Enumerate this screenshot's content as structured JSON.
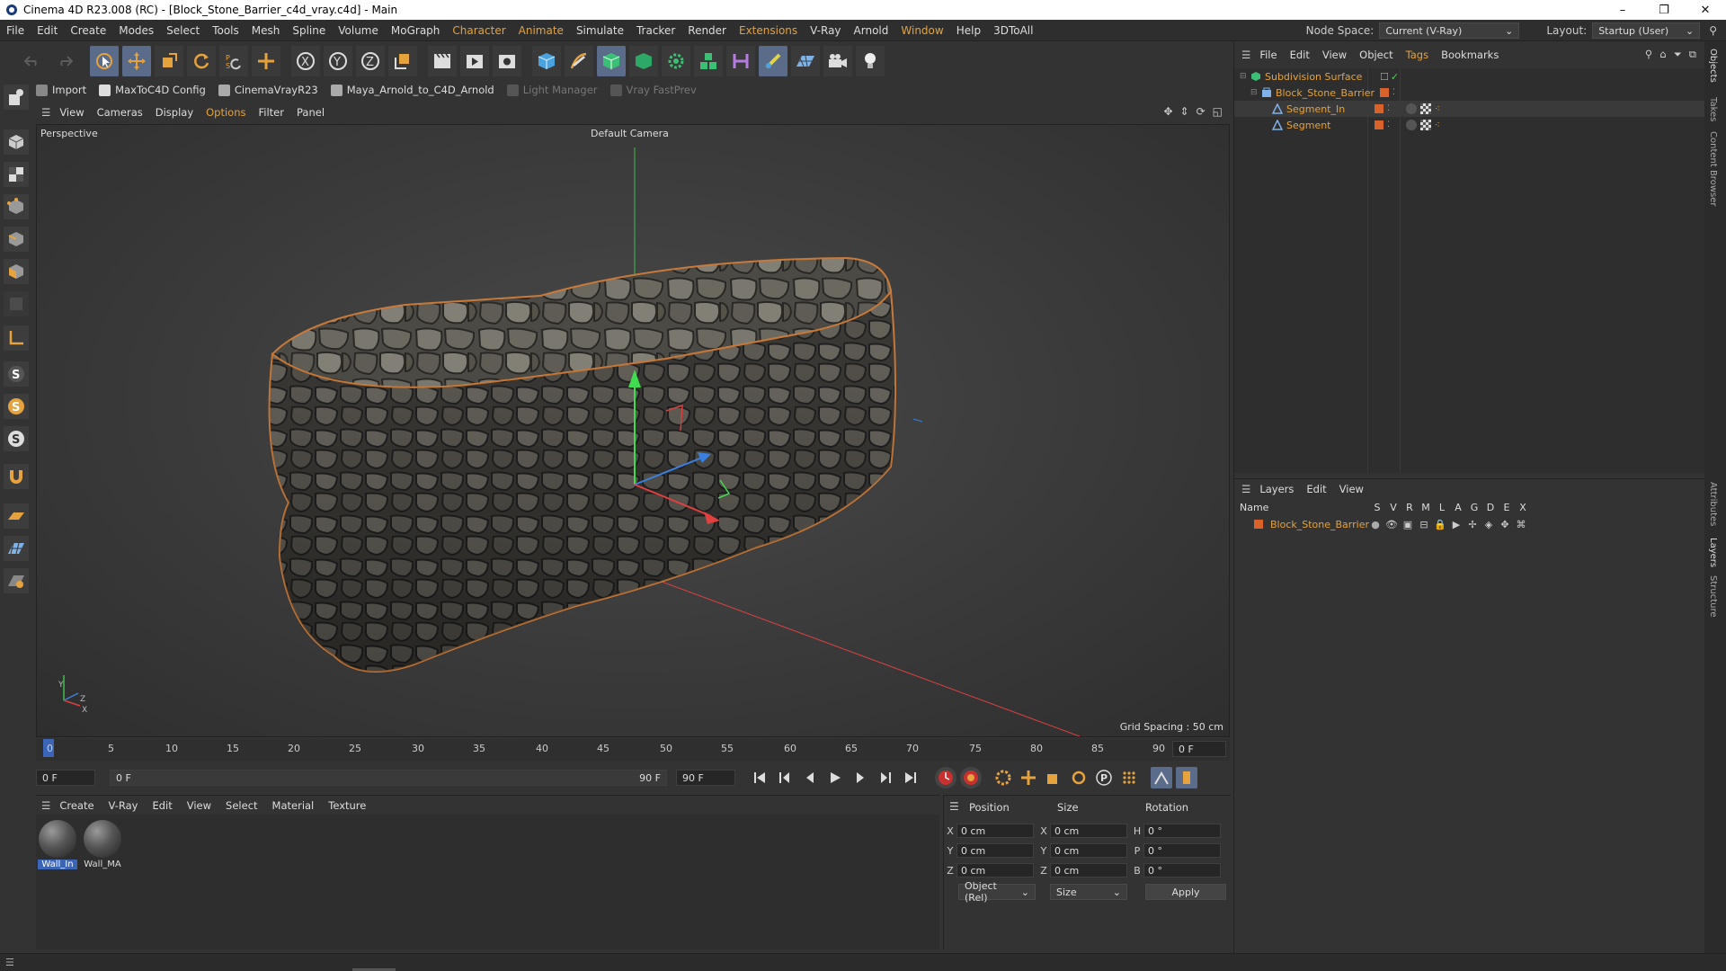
{
  "window": {
    "title": "Cinema 4D R23.008 (RC) - [Block_Stone_Barrier_c4d_vray.c4d] - Main",
    "controls": [
      "–",
      "❐",
      "✕"
    ]
  },
  "menubar": {
    "items": [
      "File",
      "Edit",
      "Create",
      "Modes",
      "Select",
      "Tools",
      "Mesh",
      "Spline",
      "Volume",
      "MoGraph",
      "Character",
      "Animate",
      "Simulate",
      "Tracker",
      "Render",
      "Extensions",
      "V-Ray",
      "Arnold",
      "Window",
      "Help",
      "3DToAll"
    ],
    "highlighted": [
      "Character",
      "Animate",
      "Extensions",
      "Window"
    ],
    "node_space_label": "Node Space:",
    "node_space_value": "Current (V-Ray)",
    "layout_label": "Layout:",
    "layout_value": "Startup (User)"
  },
  "plugins": {
    "items": [
      {
        "label": "Import",
        "enabled": true
      },
      {
        "label": "MaxToC4D Config",
        "enabled": true
      },
      {
        "label": "CinemaVrayR23",
        "enabled": true
      },
      {
        "label": "Maya_Arnold_to_C4D_Arnold",
        "enabled": true
      },
      {
        "label": "Light Manager",
        "enabled": false
      },
      {
        "label": "Vray FastPrev",
        "enabled": false
      }
    ]
  },
  "viewport": {
    "menu": [
      "View",
      "Cameras",
      "Display",
      "Options",
      "Filter",
      "Panel"
    ],
    "menu_highlight": "Options",
    "view_name": "Perspective",
    "camera": "Default Camera",
    "grid_spacing": "Grid Spacing : 50 cm",
    "axis_labels": {
      "y": "Y",
      "z": "Z",
      "x": "X"
    }
  },
  "timeline": {
    "ticks": [
      "0",
      "5",
      "10",
      "15",
      "20",
      "25",
      "30",
      "35",
      "40",
      "45",
      "50",
      "55",
      "60",
      "65",
      "70",
      "75",
      "80",
      "85",
      "90"
    ],
    "current_frame": "0 F",
    "start_field": "0 F",
    "range_start": "0 F",
    "range_end": "90 F",
    "end_field": "90 F"
  },
  "material_manager": {
    "menu": [
      "Create",
      "V-Ray",
      "Edit",
      "View",
      "Select",
      "Material",
      "Texture"
    ],
    "materials": [
      {
        "name": "Wall_In",
        "selected": true
      },
      {
        "name": "Wall_MA",
        "selected": false
      }
    ]
  },
  "coordinates": {
    "headers": [
      "Position",
      "Size",
      "Rotation"
    ],
    "rows": [
      {
        "axis": "X",
        "pos": "0 cm",
        "size_axis": "X",
        "size": "0 cm",
        "rot_axis": "H",
        "rot": "0 °"
      },
      {
        "axis": "Y",
        "pos": "0 cm",
        "size_axis": "Y",
        "size": "0 cm",
        "rot_axis": "P",
        "rot": "0 °"
      },
      {
        "axis": "Z",
        "pos": "0 cm",
        "size_axis": "Z",
        "size": "0 cm",
        "rot_axis": "B",
        "rot": "0 °"
      }
    ],
    "mode": "Object (Rel)",
    "size_mode": "Size",
    "apply": "Apply"
  },
  "object_manager": {
    "menu": [
      "File",
      "Edit",
      "View",
      "Object",
      "Tags",
      "Bookmarks"
    ],
    "menu_highlight": "Tags",
    "objects": [
      {
        "name": "Subdivision Surface",
        "indent": 0
      },
      {
        "name": "Block_Stone_Barrier",
        "indent": 1
      },
      {
        "name": "Segment_In",
        "indent": 2
      },
      {
        "name": "Segment",
        "indent": 2
      }
    ]
  },
  "layer_manager": {
    "menu": [
      "Layers",
      "Edit",
      "View"
    ],
    "columns": [
      "Name",
      "S",
      "V",
      "R",
      "M",
      "L",
      "A",
      "G",
      "D",
      "E",
      "X"
    ],
    "layers": [
      {
        "name": "Block_Stone_Barrier",
        "color": "#d9622b"
      }
    ]
  },
  "side_tabs": [
    "Objects",
    "Takes",
    "Content Browser",
    "Attributes",
    "Layers",
    "Structure"
  ],
  "colors": {
    "accent": "#e6a23c",
    "selection": "#3b66b8",
    "layer": "#d9622b"
  }
}
